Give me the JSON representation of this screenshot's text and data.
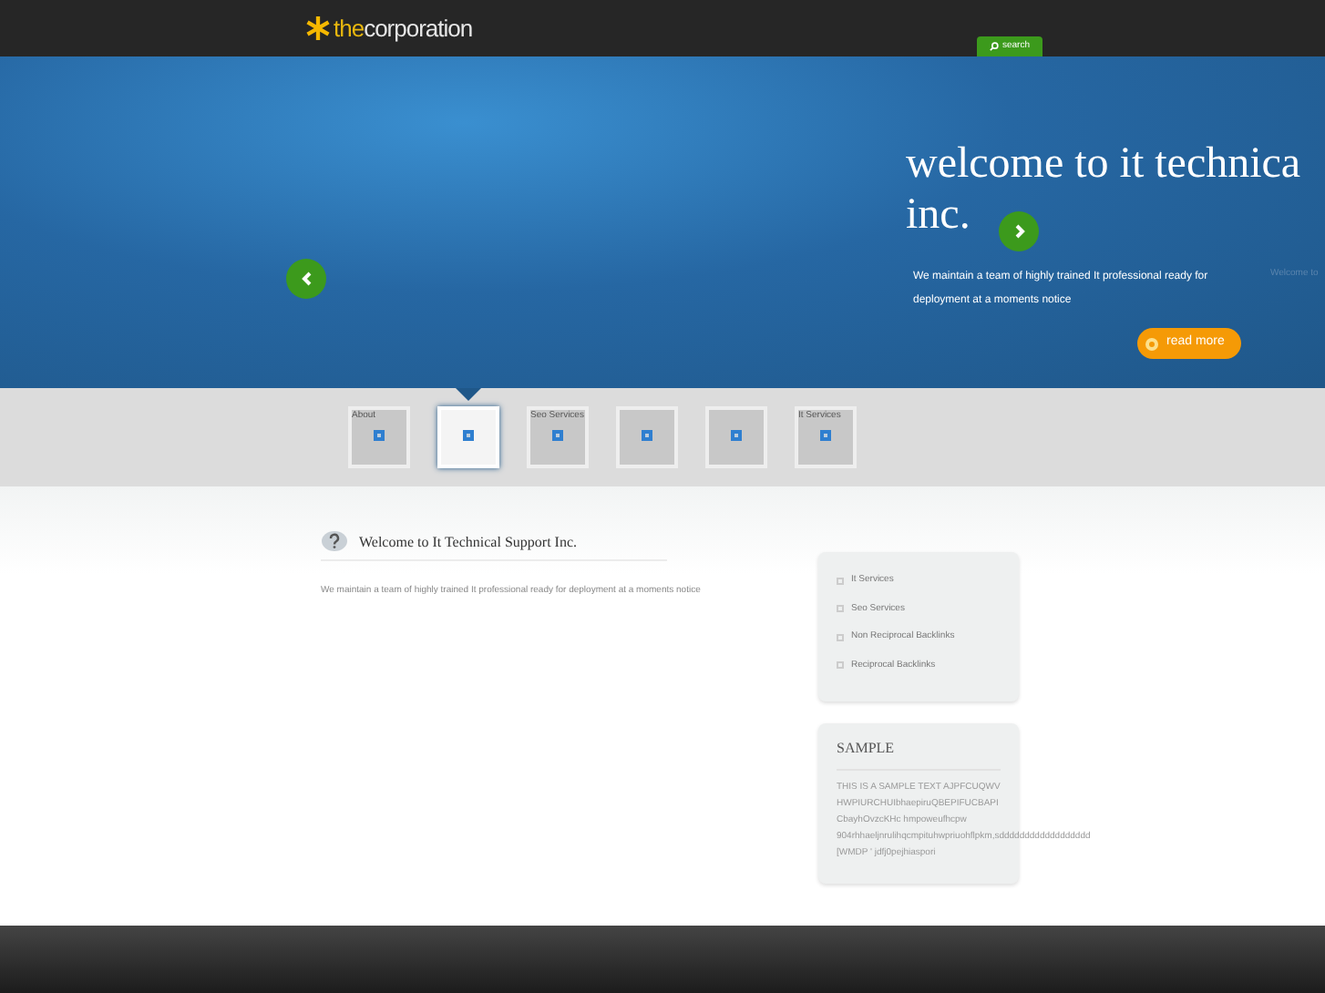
{
  "header": {
    "logo_prefix": "the",
    "logo_name": "corporation",
    "search_tab": "search"
  },
  "hero": {
    "title_lines": [
      "welcome to it technica",
      "inc."
    ],
    "text": "We maintain a team of highly trained It professional ready for deployment at a moments notice",
    "next_slide_text": "Welcome to",
    "button": "read more"
  },
  "thumbnails": [
    {
      "label": "About",
      "selected": false
    },
    {
      "selected": true
    },
    {
      "label": "Seo Services",
      "selected": false
    },
    {
      "selected": false
    },
    {
      "selected": false
    },
    {
      "label": "It Services",
      "selected": false
    }
  ],
  "main": {
    "heading": "Welcome to It Technical Support Inc.",
    "text": "We maintain a team of highly trained It professional ready for deployment at a moments notice"
  },
  "links": [
    "It Services",
    "Seo Services",
    "Non Reciprocal Backlinks",
    "Reciprocal Backlinks"
  ],
  "sample": {
    "title": "SAMPLE",
    "lines": [
      "THIS IS A SAMPLE TEXT AJPFCUQWV",
      "HWPIURCHUIbhaepiruQBEPIFUCBAPI",
      "CbayhOvzcKHc hmpoweufhcpw",
      "904rhhaeljnrulihqcmpituhwpriuohflpkm,sdddddddddddddddddd",
      "[WMDP ' jdfj0pejhiaspori"
    ]
  }
}
